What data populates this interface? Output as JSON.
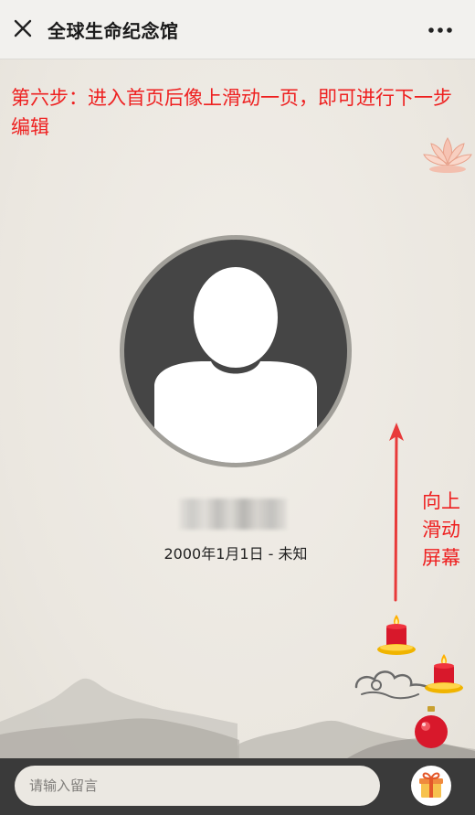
{
  "header": {
    "title": "全球生命纪念馆",
    "close_icon": "close-icon",
    "more_icon": "more-dots-icon"
  },
  "main": {
    "instruction": "第六步：进入首页后像上滑动一页，即可进行下一步编辑",
    "dates": "2000年1月1日 - 未知",
    "swipe_hint": "向上\n滑动\n屏幕",
    "avatar_icon": "default-avatar-icon"
  },
  "footer": {
    "message_placeholder": "请输入留言",
    "gift_icon": "gift-icon"
  },
  "colors": {
    "accent_red": "#ee2020",
    "background": "#ede9e2",
    "footer_bg": "#3a3a3a"
  }
}
